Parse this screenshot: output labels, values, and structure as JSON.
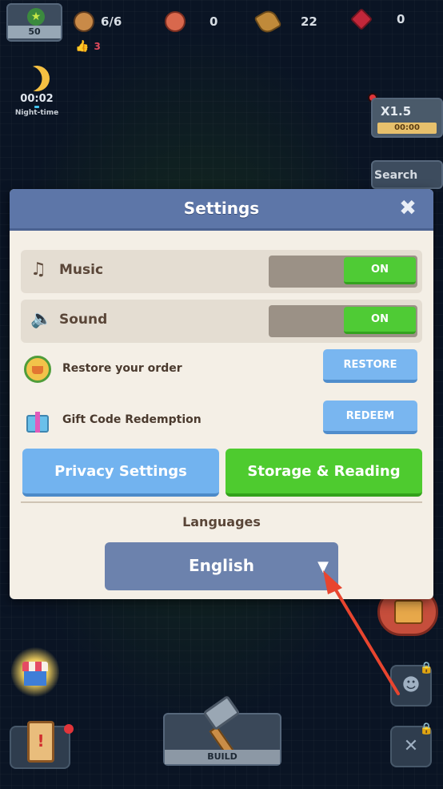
{
  "hud": {
    "level": "50",
    "population": "6/6",
    "meat": "0",
    "wood": "22",
    "gems": "0",
    "likes": "3",
    "night_timer": "00:02",
    "night_label": "Night-time",
    "speed_label": "X1.5",
    "speed_timer": "00:00",
    "search_label": "Search"
  },
  "dialog": {
    "title": "Settings",
    "music_label": "Music",
    "music_state": "ON",
    "sound_label": "Sound",
    "sound_state": "ON",
    "restore_label": "Restore your order",
    "restore_button": "RESTORE",
    "gift_label": "Gift Code Redemption",
    "redeem_button": "REDEEM",
    "privacy_button": "Privacy Settings",
    "storage_button": "Storage & Reading",
    "languages_label": "Languages",
    "language_value": "English"
  },
  "bottom": {
    "build_label": "BUILD"
  },
  "icons": {
    "close": "close-icon",
    "music": "music-note-icon",
    "sound": "speaker-icon",
    "restore": "basket-restore-icon",
    "gift": "gift-icon",
    "caret": "caret-down-icon"
  },
  "colors": {
    "header": "#5d76a8",
    "toggle_on": "#4fcb35",
    "blue_button": "#79b6f0",
    "green_button": "#4ecb2f",
    "language_select": "#6c82ad",
    "arrow": "#e8452f"
  }
}
